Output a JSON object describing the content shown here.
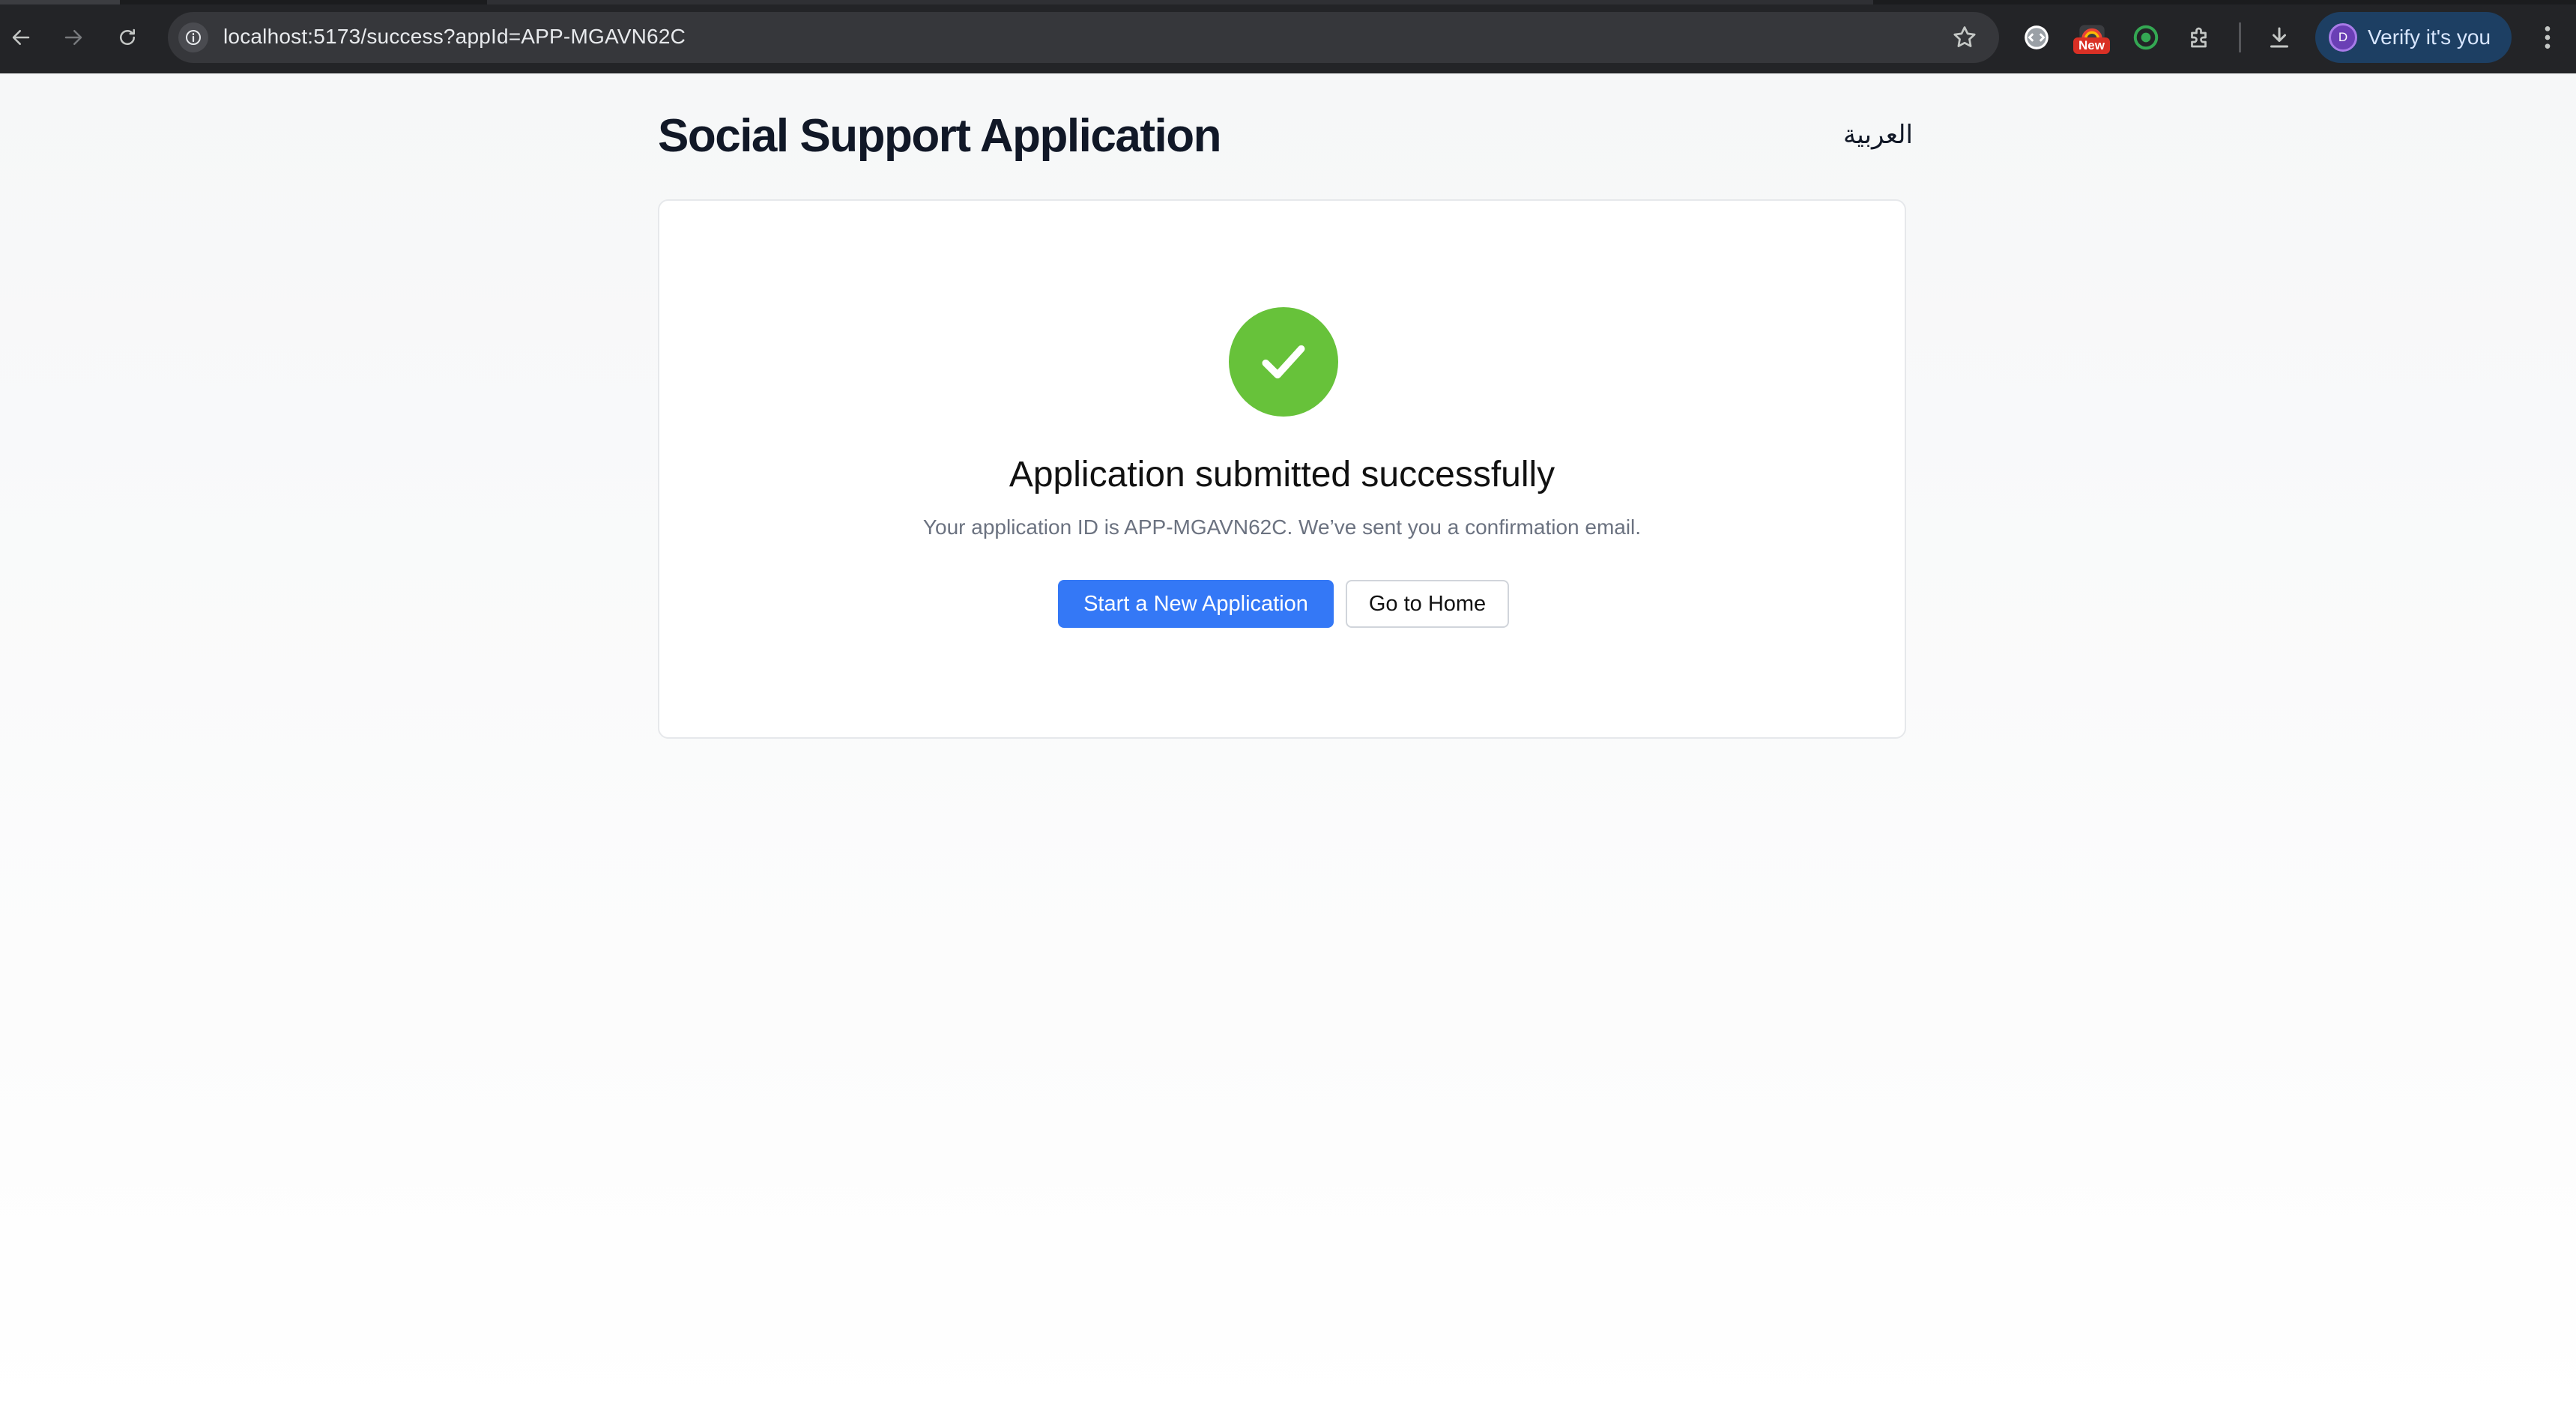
{
  "browser": {
    "url": "localhost:5173/success?appId=APP-MGAVN62C",
    "extension_badge": "New",
    "profile_initial": "D",
    "profile_label": "Verify it's you",
    "icons": [
      "back-arrow-icon",
      "forward-arrow-icon",
      "reload-icon",
      "site-info-icon",
      "bookmark-star-icon",
      "extension-icon",
      "download-icon",
      "more-menu-icon"
    ]
  },
  "header": {
    "title": "Social Support Application",
    "language_toggle": "العربية"
  },
  "success": {
    "title": "Application submitted successfully",
    "message": "Your application ID is APP-MGAVN62C. We’ve sent you a confirmation email.",
    "primary_button": "Start a New Application",
    "secondary_button": "Go to Home"
  },
  "colors": {
    "success_green": "#67c23a",
    "primary_blue": "#3478f6"
  }
}
